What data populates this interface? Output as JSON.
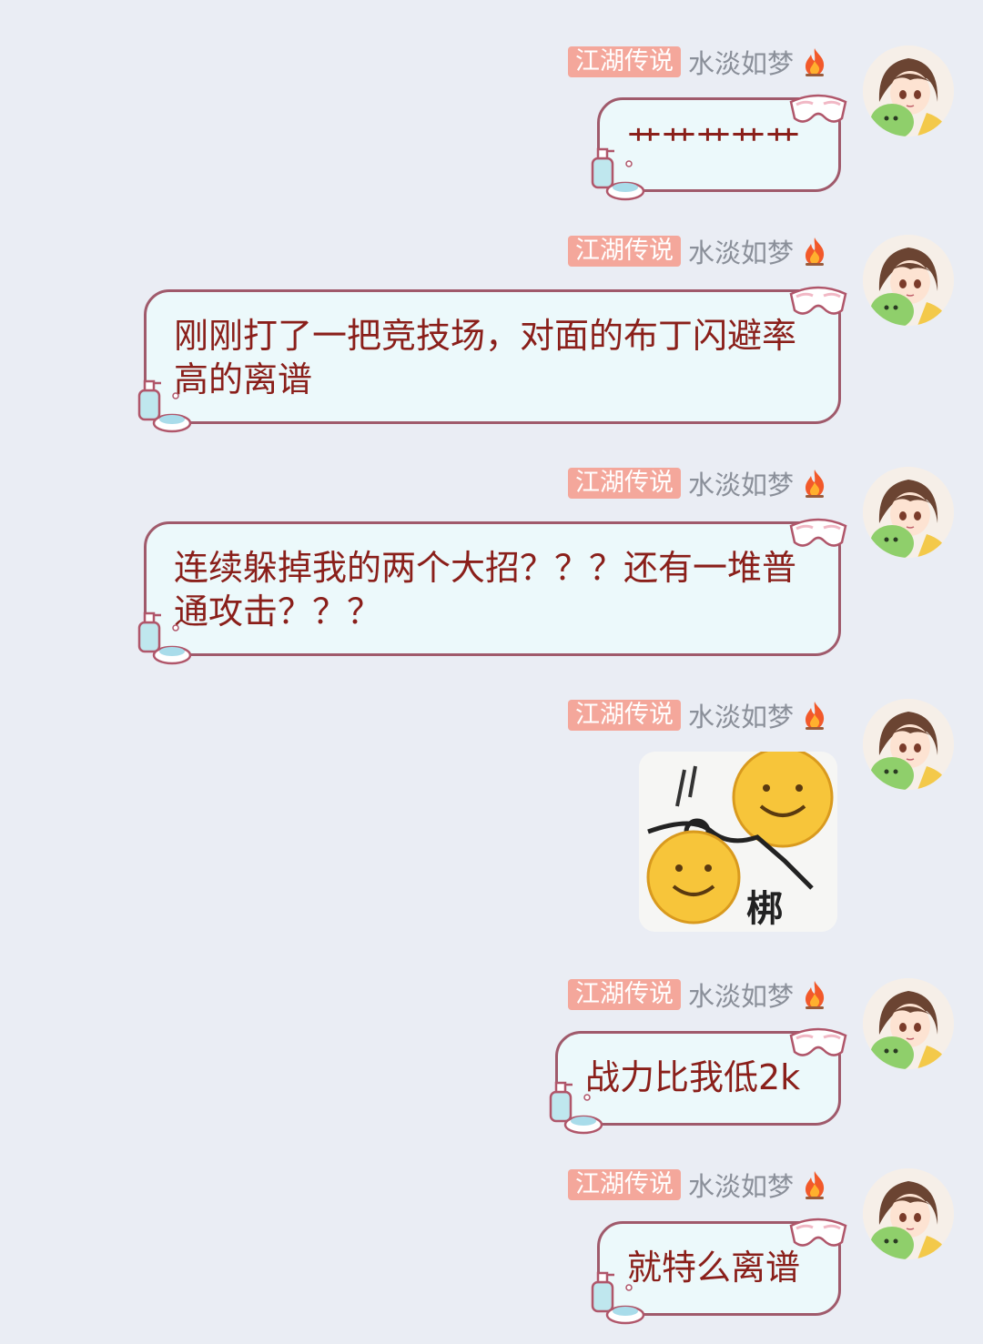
{
  "sender": {
    "badge": "江湖传说",
    "name": "水淡如梦"
  },
  "messages": [
    {
      "type": "text",
      "text": "艹艹艹艹艹"
    },
    {
      "type": "text",
      "text": "刚刚打了一把竞技场，对面的布丁闪避率高的离谱"
    },
    {
      "type": "text",
      "text": "连续躲掉我的两个大招？？？还有一堆普通攻击？？？"
    },
    {
      "type": "sticker",
      "text": "梆"
    },
    {
      "type": "text",
      "text": "战力比我低2k"
    },
    {
      "type": "text",
      "text": "就特么离谱"
    }
  ],
  "icons": {
    "flame": "flame-icon",
    "goggle": "goggle-decoration-icon",
    "soap": "soap-decoration-icon"
  },
  "colors": {
    "background": "#eaedf4",
    "badge": "#f4a79b",
    "bubble_fill": "#ecf9fb",
    "bubble_border": "#a05a6b",
    "message_text": "#8a1f1a",
    "nickname": "#8a8f99"
  }
}
